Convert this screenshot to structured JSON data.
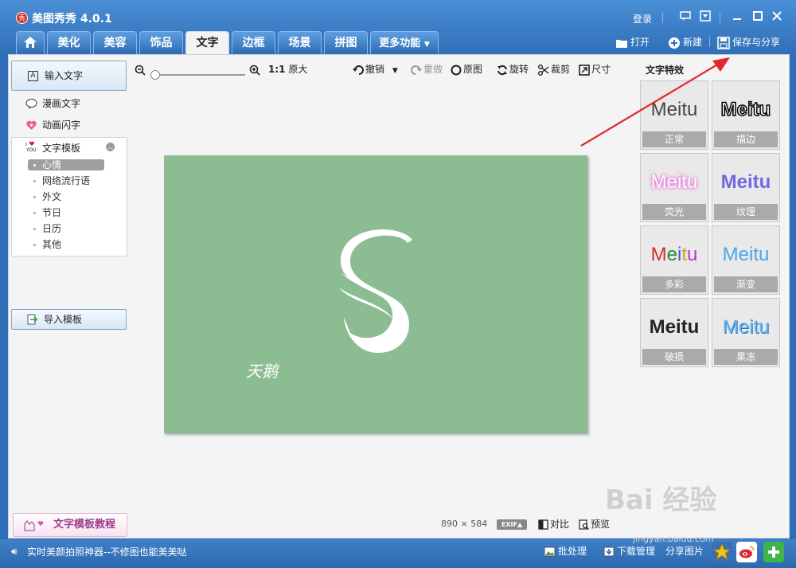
{
  "window": {
    "logo_glyph": "秀",
    "title": "美图秀秀 4.0.1",
    "login": "登录"
  },
  "tabs": [
    "美化",
    "美容",
    "饰品",
    "文字",
    "边框",
    "场景",
    "拼图",
    "更多功能"
  ],
  "header_actions": {
    "open": "打开",
    "new": "新建",
    "save": "保存与分享"
  },
  "left": {
    "input_text": "输入文字",
    "comic_text": "漫画文字",
    "animated_text": "动画闪字",
    "template_header": "文字模板",
    "template_items": [
      "心情",
      "网络流行语",
      "外文",
      "节日",
      "日历",
      "其他"
    ],
    "import_template": "导入模板",
    "tutorial": "文字模板教程"
  },
  "toolbar": {
    "one_to_one": "1:1",
    "original_size": "原大",
    "undo": "撤销",
    "redo": "重做",
    "original_image": "原图",
    "rotate": "旋转",
    "crop": "裁剪",
    "size": "尺寸"
  },
  "effects": {
    "title": "文字特效",
    "sample": "Meitu",
    "items": [
      "正常",
      "描边",
      "荧光",
      "纹理",
      "多彩",
      "渐变",
      "破损",
      "果冻"
    ]
  },
  "canvas": {
    "signature": "天鹅",
    "width": "890",
    "times": "×",
    "height": "584",
    "exif": "EXIF▲",
    "compare": "对比",
    "preview": "预览"
  },
  "status": {
    "message": "实时美颜拍照神器--不修图也能美美哒",
    "batch": "批处理",
    "download": "下载管理",
    "share": "分享图片"
  },
  "watermark": {
    "logo": "Bai 经验",
    "url": "jingyan.baidu.com"
  },
  "colors": {
    "accent": "#2f6eb7",
    "canvas_bg": "#8cbc92",
    "arrow": "#e3262b"
  }
}
